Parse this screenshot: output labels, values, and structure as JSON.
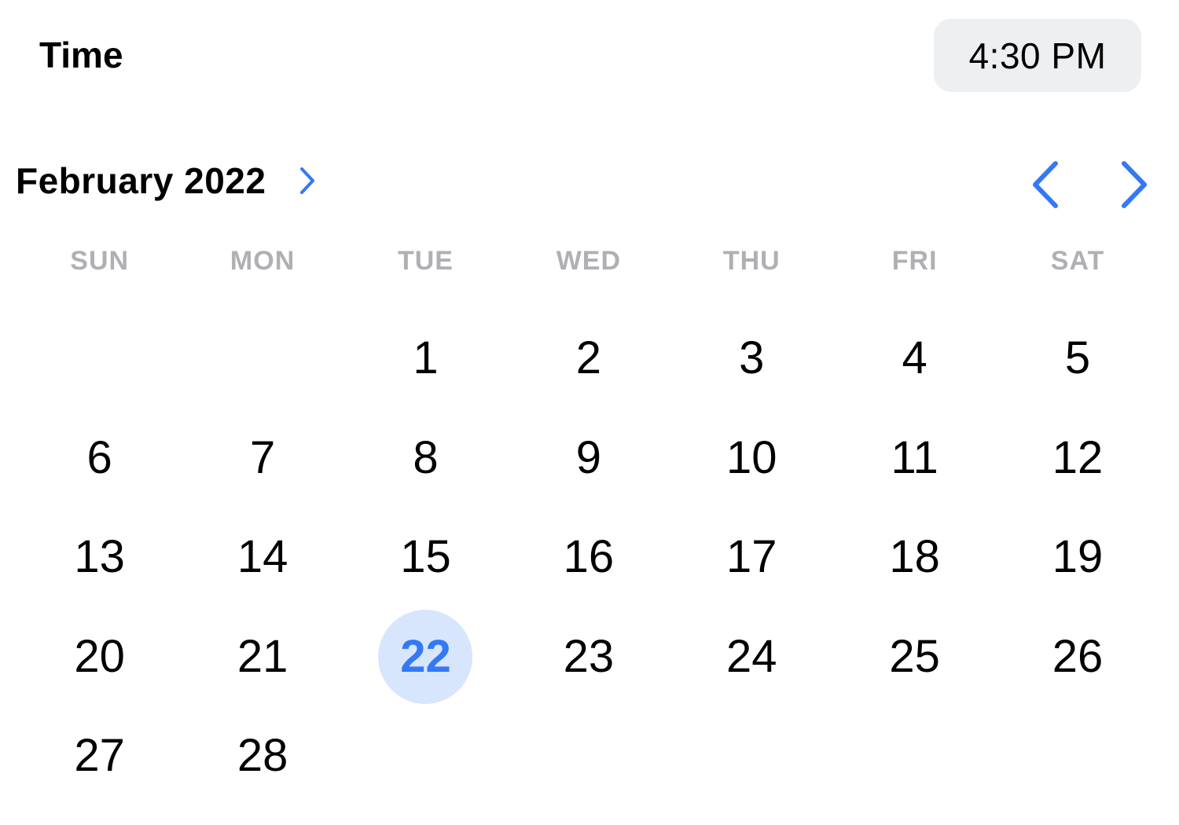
{
  "time": {
    "label": "Time",
    "value": "4:30 PM"
  },
  "calendar": {
    "month_title": "February 2022",
    "weekdays": [
      "SUN",
      "MON",
      "TUE",
      "WED",
      "THU",
      "FRI",
      "SAT"
    ],
    "leading_blanks": 2,
    "days": [
      "1",
      "2",
      "3",
      "4",
      "5",
      "6",
      "7",
      "8",
      "9",
      "10",
      "11",
      "12",
      "13",
      "14",
      "15",
      "16",
      "17",
      "18",
      "19",
      "20",
      "21",
      "22",
      "23",
      "24",
      "25",
      "26",
      "27",
      "28"
    ],
    "selected_day": "22"
  },
  "icons": {
    "month_toggle": "chevron-right-icon",
    "previous_month": "chevron-left-icon",
    "next_month": "chevron-right-icon"
  },
  "colors": {
    "accent": "#3478f6",
    "selected_bg": "#d7e6fd",
    "weekday_text": "#b0b0b4",
    "time_pill_bg": "#eeeff1"
  }
}
